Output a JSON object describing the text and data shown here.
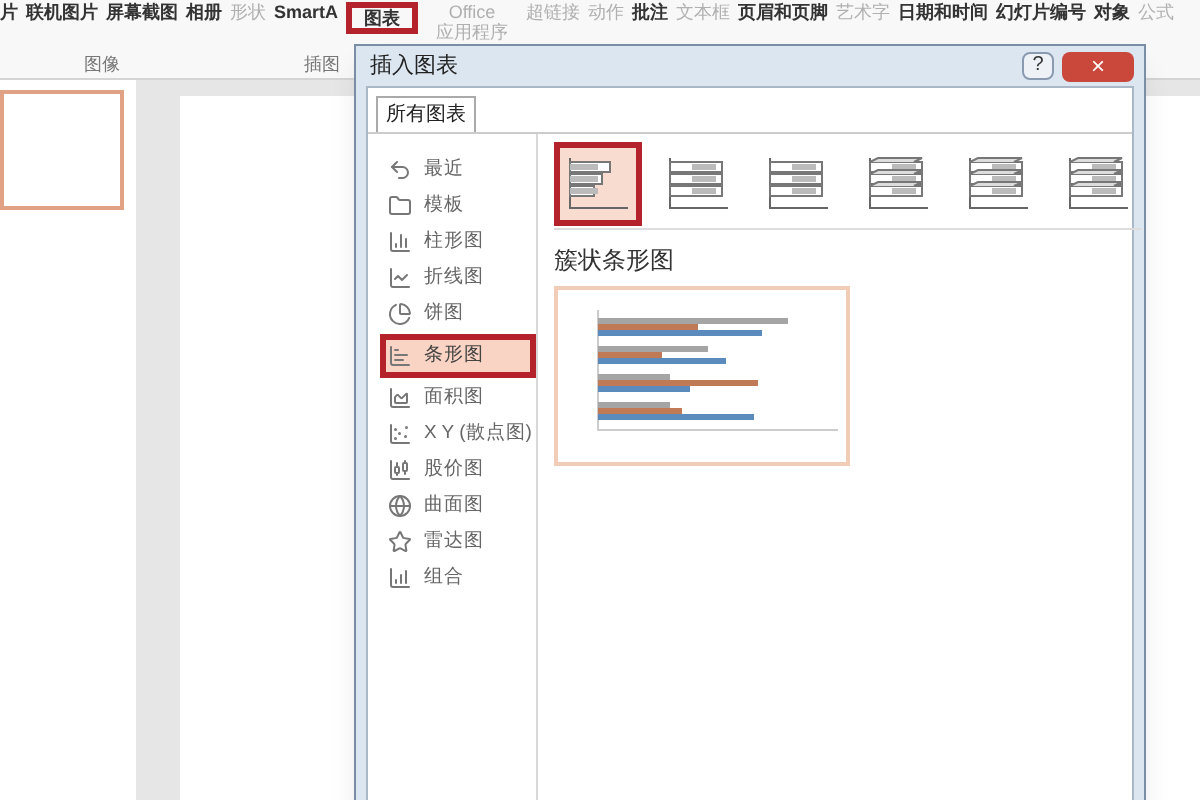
{
  "ribbon": {
    "items": [
      {
        "label": "片",
        "disabled": false,
        "highlighted": false
      },
      {
        "label": "联机图片",
        "disabled": false,
        "highlighted": false
      },
      {
        "label": "屏幕截图",
        "disabled": false,
        "highlighted": false
      },
      {
        "label": "相册",
        "disabled": false,
        "highlighted": false
      },
      {
        "label": "形状",
        "disabled": true,
        "highlighted": false
      },
      {
        "label": "SmartA",
        "disabled": false,
        "highlighted": false
      },
      {
        "label": "图表",
        "disabled": false,
        "highlighted": true
      },
      {
        "label": "Office 应用程序",
        "disabled": true,
        "highlighted": false
      },
      {
        "label": "超链接",
        "disabled": true,
        "highlighted": false
      },
      {
        "label": "动作",
        "disabled": true,
        "highlighted": false
      },
      {
        "label": "批注",
        "disabled": false,
        "highlighted": false
      },
      {
        "label": "文本框",
        "disabled": true,
        "highlighted": false
      },
      {
        "label": "页眉和页脚",
        "disabled": false,
        "highlighted": false
      },
      {
        "label": "艺术字",
        "disabled": true,
        "highlighted": false
      },
      {
        "label": "日期和时间",
        "disabled": false,
        "highlighted": false
      },
      {
        "label": "幻灯片编号",
        "disabled": false,
        "highlighted": false
      },
      {
        "label": "对象",
        "disabled": false,
        "highlighted": false
      },
      {
        "label": "公式",
        "disabled": true,
        "highlighted": false
      }
    ],
    "groups": [
      "图像",
      "插图"
    ]
  },
  "dialog": {
    "title": "插入图表",
    "help": "?",
    "close": "×",
    "tabs": [
      {
        "label": "所有图表",
        "selected": true
      }
    ],
    "chart_types": [
      {
        "label": "最近",
        "selected": false,
        "highlighted": false
      },
      {
        "label": "模板",
        "selected": false,
        "highlighted": false
      },
      {
        "label": "柱形图",
        "selected": false,
        "highlighted": false
      },
      {
        "label": "折线图",
        "selected": false,
        "highlighted": false
      },
      {
        "label": "饼图",
        "selected": false,
        "highlighted": false
      },
      {
        "label": "条形图",
        "selected": true,
        "highlighted": true
      },
      {
        "label": "面积图",
        "selected": false,
        "highlighted": false
      },
      {
        "label": "X Y (散点图)",
        "selected": false,
        "highlighted": false
      },
      {
        "label": "股价图",
        "selected": false,
        "highlighted": false
      },
      {
        "label": "曲面图",
        "selected": false,
        "highlighted": false
      },
      {
        "label": "雷达图",
        "selected": false,
        "highlighted": false
      },
      {
        "label": "组合",
        "selected": false,
        "highlighted": false
      }
    ],
    "subtypes": [
      {
        "selected": true,
        "highlighted": true
      },
      {
        "selected": false,
        "highlighted": false
      },
      {
        "selected": false,
        "highlighted": false
      },
      {
        "selected": false,
        "highlighted": false
      },
      {
        "selected": false,
        "highlighted": false
      },
      {
        "selected": false,
        "highlighted": false
      }
    ],
    "subtype_title": "簇状条形图"
  }
}
